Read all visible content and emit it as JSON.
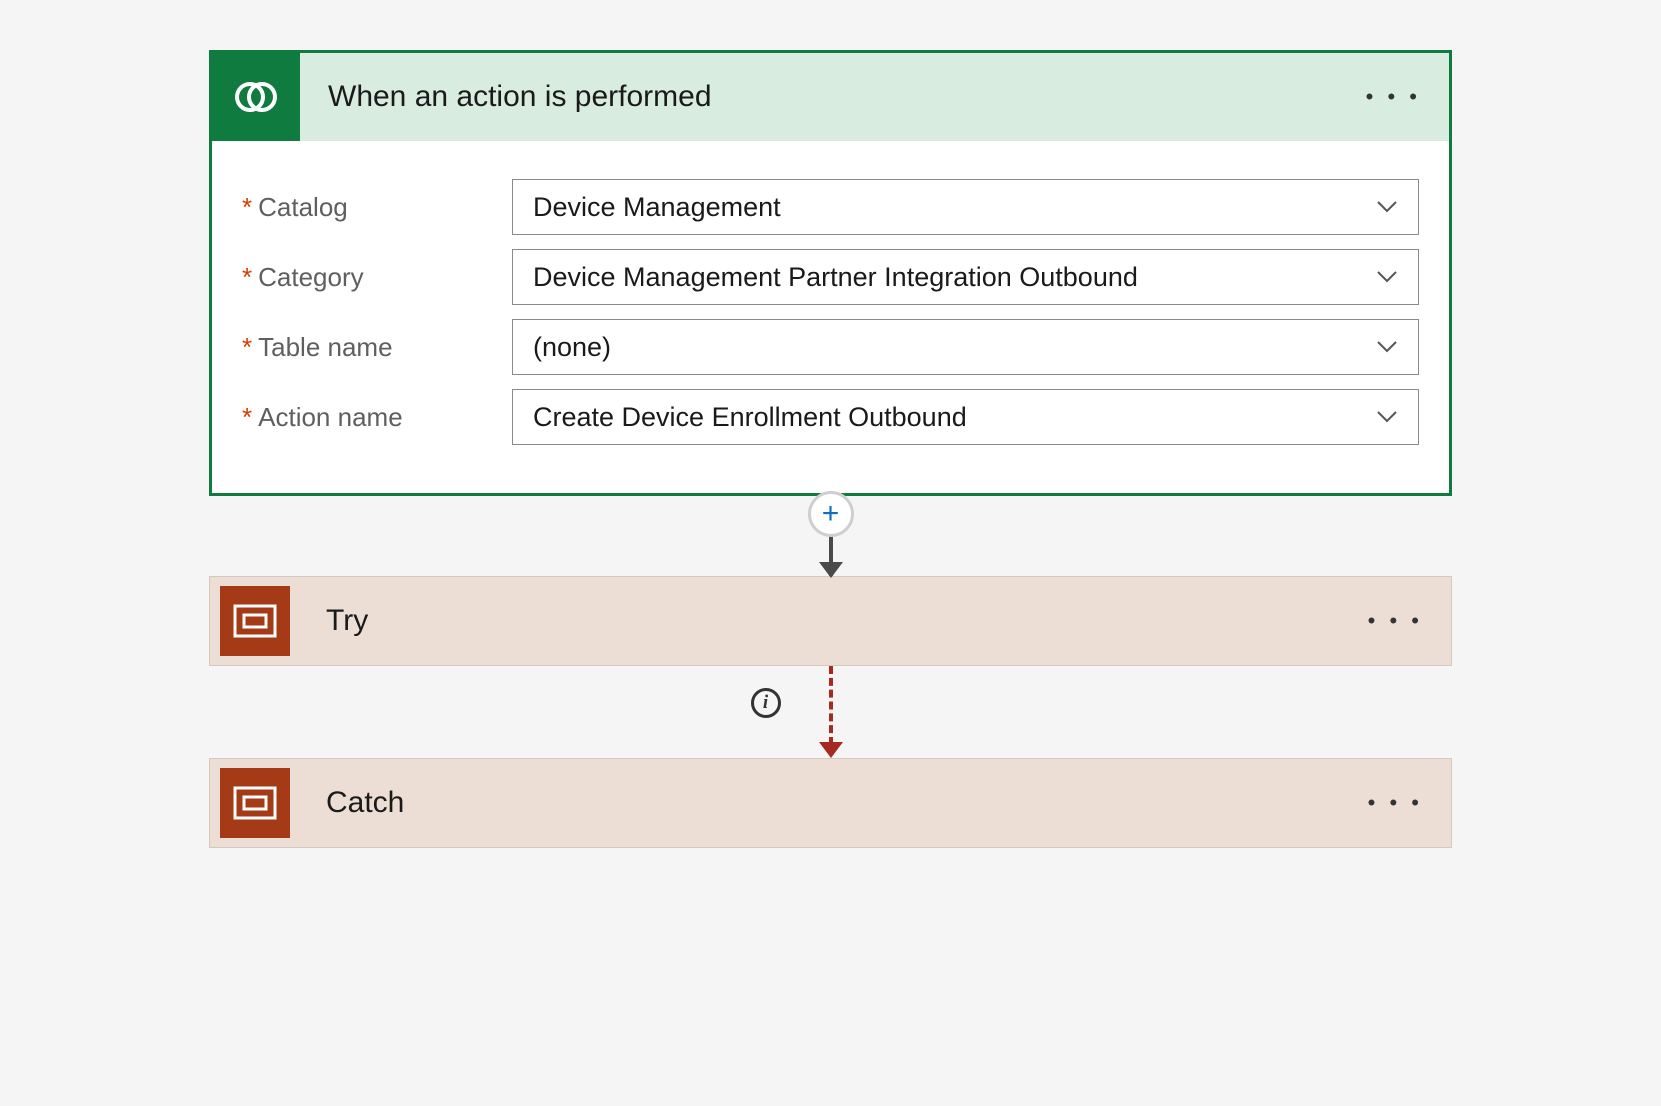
{
  "trigger": {
    "title": "When an action is performed",
    "fields": {
      "catalog": {
        "label": "Catalog",
        "value": "Device Management"
      },
      "category": {
        "label": "Category",
        "value": "Device Management Partner Integration Outbound"
      },
      "table_name": {
        "label": "Table name",
        "value": "(none)"
      },
      "action_name": {
        "label": "Action name",
        "value": "Create Device Enrollment Outbound"
      }
    }
  },
  "steps": {
    "try": {
      "title": "Try"
    },
    "catch": {
      "title": "Catch"
    }
  },
  "glyph": {
    "plus": "+",
    "info": "i",
    "ellipsis": "• • •"
  }
}
